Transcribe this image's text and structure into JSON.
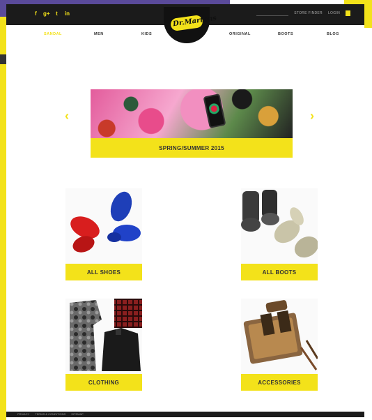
{
  "nav": {
    "items": [
      "SANDAL",
      "MEN",
      "KIDS",
      "ORIGINAL",
      "BOOTS",
      "BLOG"
    ],
    "active_index": 0
  },
  "topbar": {
    "social": [
      "f",
      "g+",
      "t",
      "in"
    ],
    "links": [
      "STORE FINDER",
      "LOGIN"
    ]
  },
  "brand": {
    "logo_text": "Dr.Martens"
  },
  "hero": {
    "caption": "SPRING/SUMMER 2015"
  },
  "tiles": [
    {
      "caption": "ALL SHOES"
    },
    {
      "caption": "ALL BOOTS"
    },
    {
      "caption": "CLOTHING"
    },
    {
      "caption": "ACCESSORIES"
    }
  ],
  "footer": {
    "links": [
      "PRIVACY",
      "TERMS & CONDITIONS",
      "SITEMAP"
    ]
  },
  "colors": {
    "accent": "#f3e21a",
    "dark": "#1b1b1b"
  }
}
